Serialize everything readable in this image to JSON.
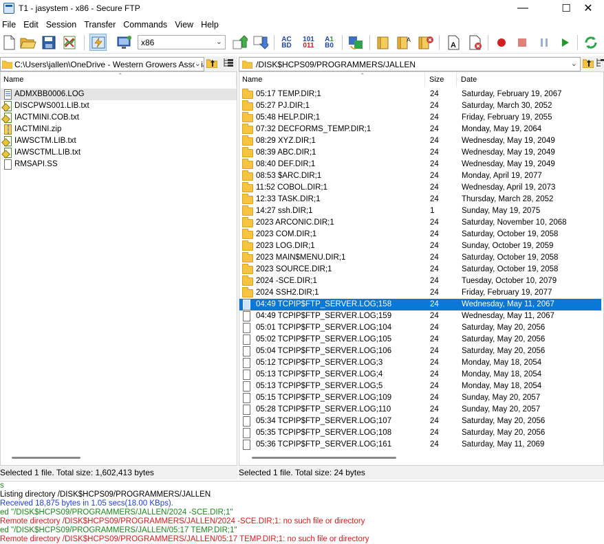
{
  "window": {
    "title": "T1 - jasystem - x86 - Secure FTP",
    "minimize_glyph": "—",
    "maximize_glyph": "☐",
    "close_glyph": "✕"
  },
  "menu": [
    "File",
    "Edit",
    "Session",
    "Transfer",
    "Commands",
    "View",
    "Help"
  ],
  "toolbar": {
    "site_combo_value": "x86",
    "transfer_icons": {
      "ascii": "AC\nBD",
      "binary": "101\n011",
      "auto": "A1\nB0"
    }
  },
  "local": {
    "path": "C:\\Users\\jallen\\OneDrive - Western Growers Associati",
    "column_name": "Name",
    "files": [
      {
        "name": "ADMXBB0006.LOG",
        "icon": "log-file-icon",
        "selected": true
      },
      {
        "name": "DISCPWS001.LIB.txt",
        "icon": "text-file-icon"
      },
      {
        "name": "IACTMINI.COB.txt",
        "icon": "text-file-icon"
      },
      {
        "name": "IACTMINI.zip",
        "icon": "zip-file-icon"
      },
      {
        "name": "IAWSCTM.LIB.txt",
        "icon": "text-file-icon"
      },
      {
        "name": "IAWSCTML.LIB.txt",
        "icon": "text-file-icon"
      },
      {
        "name": "RMSAPI.SS",
        "icon": "file-icon"
      }
    ],
    "status": "Selected 1 file. Total size: 1,602,413 bytes"
  },
  "remote": {
    "path": "/DISK$HCPS09/PROGRAMMERS/JALLEN",
    "columns": {
      "name": "Name",
      "size": "Size",
      "date": "Date"
    },
    "files": [
      {
        "name": "05:17 TEMP.DIR;1",
        "size": "24",
        "date": "Saturday, February 19, 2067",
        "type": "folder"
      },
      {
        "name": "05:27 PJ.DIR;1",
        "size": "24",
        "date": "Saturday, March 30, 2052",
        "type": "folder"
      },
      {
        "name": "05:48 HELP.DIR;1",
        "size": "24",
        "date": "Friday, February 19, 2055",
        "type": "folder"
      },
      {
        "name": "07:32 DECFORMS_TEMP.DIR;1",
        "size": "24",
        "date": "Monday, May 19, 2064",
        "type": "folder"
      },
      {
        "name": "08:29 XYZ.DIR;1",
        "size": "24",
        "date": "Wednesday, May 19, 2049",
        "type": "folder"
      },
      {
        "name": "08:39 ABC.DIR;1",
        "size": "24",
        "date": "Wednesday, May 19, 2049",
        "type": "folder"
      },
      {
        "name": "08:40 DEF.DIR;1",
        "size": "24",
        "date": "Wednesday, May 19, 2049",
        "type": "folder"
      },
      {
        "name": "08:53 $ARC.DIR;1",
        "size": "24",
        "date": "Monday, April 19, 2077",
        "type": "folder"
      },
      {
        "name": "11:52 COBOL.DIR;1",
        "size": "24",
        "date": "Wednesday, April 19, 2073",
        "type": "folder"
      },
      {
        "name": "12:33 TASK.DIR;1",
        "size": "24",
        "date": "Thursday, March 28, 2052",
        "type": "folder"
      },
      {
        "name": "14:27 ssh.DIR;1",
        "size": "1",
        "date": "Sunday, May 19, 2075",
        "type": "folder"
      },
      {
        "name": "2023 ARCONIC.DIR;1",
        "size": "24",
        "date": "Saturday, November 10, 2068",
        "type": "folder"
      },
      {
        "name": "2023 COM.DIR;1",
        "size": "24",
        "date": "Saturday, October 19, 2058",
        "type": "folder"
      },
      {
        "name": "2023 LOG.DIR;1",
        "size": "24",
        "date": "Sunday, October 19, 2059",
        "type": "folder"
      },
      {
        "name": "2023 MAIN$MENU.DIR;1",
        "size": "24",
        "date": "Saturday, October 19, 2058",
        "type": "folder"
      },
      {
        "name": "2023 SOURCE.DIR;1",
        "size": "24",
        "date": "Saturday, October 19, 2058",
        "type": "folder"
      },
      {
        "name": "2024 -SCE.DIR;1",
        "size": "24",
        "date": "Tuesday, October 10, 2079",
        "type": "folder"
      },
      {
        "name": "2024 SSH2.DIR;1",
        "size": "24",
        "date": "Friday, February 19, 2077",
        "type": "folder"
      },
      {
        "name": "04:49 TCPIP$FTP_SERVER.LOG;158",
        "size": "24",
        "date": "Wednesday, May 11, 2067",
        "type": "file",
        "selected": true
      },
      {
        "name": "04:49 TCPIP$FTP_SERVER.LOG;159",
        "size": "24",
        "date": "Wednesday, May 11, 2067",
        "type": "file"
      },
      {
        "name": "05:01 TCPIP$FTP_SERVER.LOG;104",
        "size": "24",
        "date": "Saturday, May 20, 2056",
        "type": "file"
      },
      {
        "name": "05:02 TCPIP$FTP_SERVER.LOG;105",
        "size": "24",
        "date": "Saturday, May 20, 2056",
        "type": "file"
      },
      {
        "name": "05:04 TCPIP$FTP_SERVER.LOG;106",
        "size": "24",
        "date": "Saturday, May 20, 2056",
        "type": "file"
      },
      {
        "name": "05:12 TCPIP$FTP_SERVER.LOG;3",
        "size": "24",
        "date": "Monday, May 18, 2054",
        "type": "file"
      },
      {
        "name": "05:13 TCPIP$FTP_SERVER.LOG;4",
        "size": "24",
        "date": "Monday, May 18, 2054",
        "type": "file"
      },
      {
        "name": "05:13 TCPIP$FTP_SERVER.LOG;5",
        "size": "24",
        "date": "Monday, May 18, 2054",
        "type": "file"
      },
      {
        "name": "05:15 TCPIP$FTP_SERVER.LOG;109",
        "size": "24",
        "date": "Sunday, May 20, 2057",
        "type": "file"
      },
      {
        "name": "05:28 TCPIP$FTP_SERVER.LOG;110",
        "size": "24",
        "date": "Sunday, May 20, 2057",
        "type": "file"
      },
      {
        "name": "05:34 TCPIP$FTP_SERVER.LOG;107",
        "size": "24",
        "date": "Saturday, May 20, 2056",
        "type": "file"
      },
      {
        "name": "05:35 TCPIP$FTP_SERVER.LOG;108",
        "size": "24",
        "date": "Saturday, May 20, 2056",
        "type": "file"
      },
      {
        "name": "05:36 TCPIP$FTP_SERVER.LOG;161",
        "size": "24",
        "date": "Saturday, May 11, 2069",
        "type": "file"
      }
    ],
    "status": "Selected 1 file. Total size: 24 bytes"
  },
  "log": {
    "colors": {
      "green": "#1a8a1a",
      "blue": "#1f3fd6",
      "red": "#e01b1b",
      "black": "#000000"
    },
    "lines": [
      {
        "text": "s",
        "color": "green"
      },
      {
        "text": "Listing directory /DISK$HCPS09/PROGRAMMERS/JALLEN",
        "color": "black"
      },
      {
        "text": "Received 18,875 bytes in 1.05 secs(18.00 KBps).",
        "color": "blue"
      },
      {
        "text": "ed \"/DISK$HCPS09/PROGRAMMERS/JALLEN/2024 -SCE.DIR;1\"",
        "color": "green"
      },
      {
        "text": "Remote directory /DISK$HCPS09/PROGRAMMERS/JALLEN/2024 -SCE.DIR;1: no such file or directory",
        "color": "red"
      },
      {
        "text": "ed \"/DISK$HCPS09/PROGRAMMERS/JALLEN/05:17 TEMP.DIR;1\"",
        "color": "green"
      },
      {
        "text": "Remote directory /DISK$HCPS09/PROGRAMMERS/JALLEN/05:17 TEMP.DIR;1: no such file or directory",
        "color": "red"
      }
    ]
  }
}
